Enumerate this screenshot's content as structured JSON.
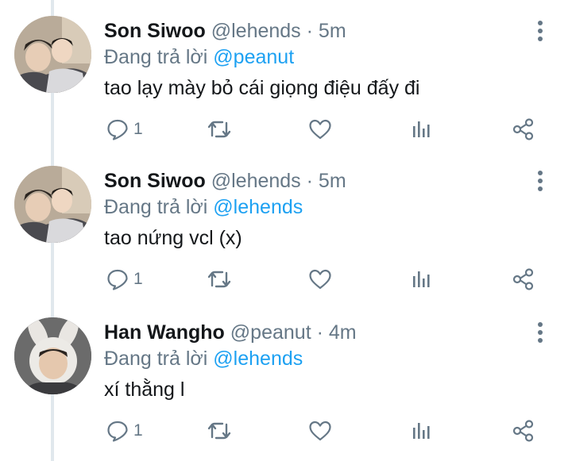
{
  "thread": {
    "reply_prefix": "Đang trả lời",
    "tweets": [
      {
        "name": "Son Siwoo",
        "handle": "@lehends",
        "sep": "·",
        "time": "5m",
        "reply_to": "@peanut",
        "text": "tao lạy mày bỏ cái giọng điệu đấy đi",
        "reply_count": "1",
        "avatar_icon": "user-photo-avatar"
      },
      {
        "name": "Son Siwoo",
        "handle": "@lehends",
        "sep": "·",
        "time": "5m",
        "reply_to": "@lehends",
        "text": "tao nứng vcl (x)",
        "reply_count": "1",
        "avatar_icon": "user-photo-avatar"
      },
      {
        "name": "Han Wangho",
        "handle": "@peanut",
        "sep": "·",
        "time": "4m",
        "reply_to": "@lehends",
        "text": "xí thằng l",
        "reply_count": "1",
        "avatar_icon": "user-photo-avatar-bunny-hood"
      }
    ]
  },
  "icons": {
    "reply": "comment-icon",
    "retweet": "retweet-icon",
    "like": "heart-icon",
    "analytics": "bar-chart-icon",
    "share": "share-icon",
    "more": "more-vertical-icon"
  },
  "colors": {
    "link": "#1da1f2",
    "muted": "#657786",
    "icon": "#657786",
    "thread_line": "#e1e8ed"
  }
}
